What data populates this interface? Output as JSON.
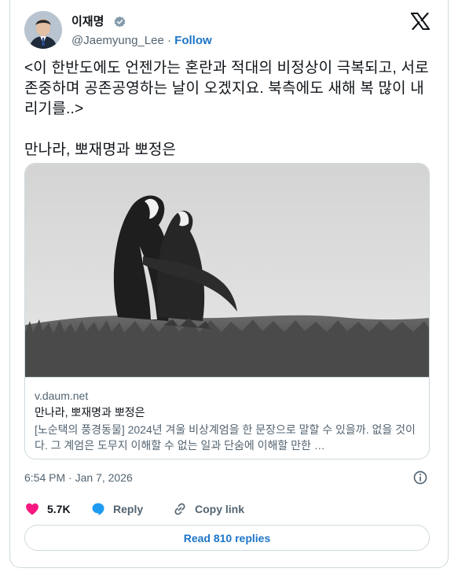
{
  "author": {
    "display_name": "이재명",
    "handle": "@Jaemyung_Lee",
    "separator": "·",
    "follow_label": "Follow"
  },
  "tweet": {
    "text": "<이 한반도에도 언젠가는 혼란과 적대의 비정상이 극복되고, 서로 존중하며 공존공영하는 날이 오겠지요. 북측에도 새해 복 많이 내리기를..>\n\n만나라, 뽀재명과 뽀정은"
  },
  "link_card": {
    "domain": "v.daum.net",
    "title": "만나라, 뽀재명과 뽀정은",
    "description": "[노순택의 풍경동물] 2024년 겨울 비상계엄을 한 문장으로 말할 수 있을까. 없을 것이다. 그 계엄은 도무지 이해할 수 없는 일과 단숨에 이해할 만한 …"
  },
  "meta": {
    "timestamp": "6:54 PM · Jan 7, 2026"
  },
  "actions": {
    "like_count": "5.7K",
    "reply_label": "Reply",
    "copy_link_label": "Copy link"
  },
  "read_replies_label": "Read 810 replies",
  "colors": {
    "accent": "#1d75c9",
    "like": "#f91880",
    "reply": "#1d9bf0",
    "muted": "#536471",
    "border": "#cfd9de"
  },
  "icons": [
    "verified-badge-icon",
    "x-logo-icon",
    "info-icon",
    "heart-icon",
    "reply-bubble-icon",
    "link-icon"
  ]
}
